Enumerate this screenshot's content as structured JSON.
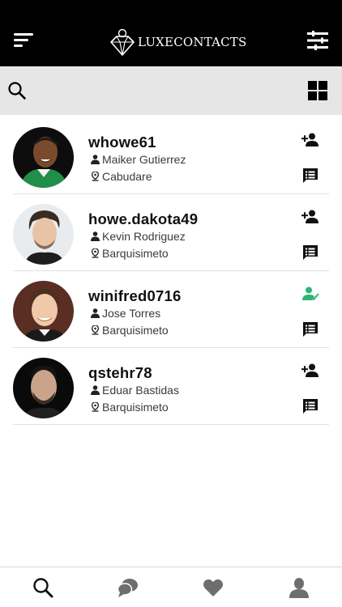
{
  "header": {
    "logo_text": "LUXECONTACTS",
    "menu_icon": "hamburger-menu-icon",
    "filter_icon": "sliders-filter-icon"
  },
  "search": {
    "search_icon": "search-icon",
    "view_toggle_icon": "grid-view-icon"
  },
  "contacts": [
    {
      "username": "whowe61",
      "full_name": "Maiker Gutierrez",
      "city": "Cabudare",
      "status": "add-contact",
      "status_color": "#111111"
    },
    {
      "username": "howe.dakota49",
      "full_name": "Kevin Rodriguez",
      "city": "Barquisimeto",
      "status": "add-contact",
      "status_color": "#111111"
    },
    {
      "username": "winifred0716",
      "full_name": "Jose Torres",
      "city": "Barquisimeto",
      "status": "contact-added",
      "status_color": "#2bb673"
    },
    {
      "username": "qstehr78",
      "full_name": "Eduar Bastidas",
      "city": "Barquisimeto",
      "status": "add-contact",
      "status_color": "#111111"
    }
  ],
  "bottom_nav": {
    "items": [
      "search-icon",
      "chat-bubbles-icon",
      "heart-icon",
      "profile-icon"
    ],
    "active_color": "#111111",
    "inactive_color": "#6e6e6e"
  }
}
